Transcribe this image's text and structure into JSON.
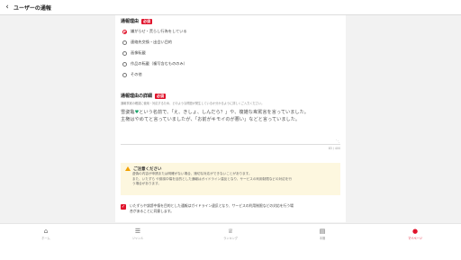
{
  "header": {
    "back_icon": "chevron-left-icon",
    "title": "ユーザーの通報"
  },
  "reason": {
    "label": "通報理由",
    "required": "必須",
    "options": [
      {
        "label": "嫌がらせ・荒らし行為をしている",
        "checked": true
      },
      {
        "label": "連絡先交換・出会い目的",
        "checked": false
      },
      {
        "label": "画像転載",
        "checked": false
      },
      {
        "label": "作品の転載（複写含むもののみ）",
        "checked": false
      },
      {
        "label": "その他",
        "checked": false
      }
    ]
  },
  "detail": {
    "label": "通報理由の詳細",
    "required": "必須",
    "note": "通報事実の確認に使用・対応するため、どのような問題が発生しているか分かるように詳しくご入力ください。",
    "line1_pre": "雪姿亀",
    "line1_post": "という名前で、「え、きしょ、しんだら？」や、複雑な卑罵言を言っていました。",
    "line2": "主権はやめてと言っていましたが、「お前がキモイのが悪い」などと言っていました。",
    "counter": "83 / 400",
    "heart_color": "#1aa46b"
  },
  "warning": {
    "icon": "warning-icon",
    "title": "ご注意ください",
    "lines": [
      "虚偽の内容が申請または明確がない場合、適切な対応ができないことがあります。",
      "また、いたずら や誹謗中傷を目的とした通報はガイドライン違反となり、サービスの利用制限などの対応を行",
      "う場合があります。"
    ]
  },
  "agreement": {
    "checked": true,
    "line1": "いたずらや誹謗中傷を目的とした通報はガイドライン違反となり、サービスの利用制限などの対応を行う場",
    "line2": "合があることに同意します。"
  },
  "tabbar": {
    "items": [
      {
        "label": "ホーム",
        "icon": "home-icon",
        "active": false
      },
      {
        "label": "ジャンル",
        "icon": "list-icon",
        "active": false
      },
      {
        "label": "ランキング",
        "icon": "crown-icon",
        "active": false
      },
      {
        "label": "本棚",
        "icon": "bookshelf-icon",
        "active": false
      },
      {
        "label": "マイページ",
        "icon": "person-icon",
        "active": true
      }
    ]
  },
  "colors": {
    "accent": "#e0142c",
    "warning_bg": "#fdf7df",
    "warning_icon": "#f2a100"
  }
}
